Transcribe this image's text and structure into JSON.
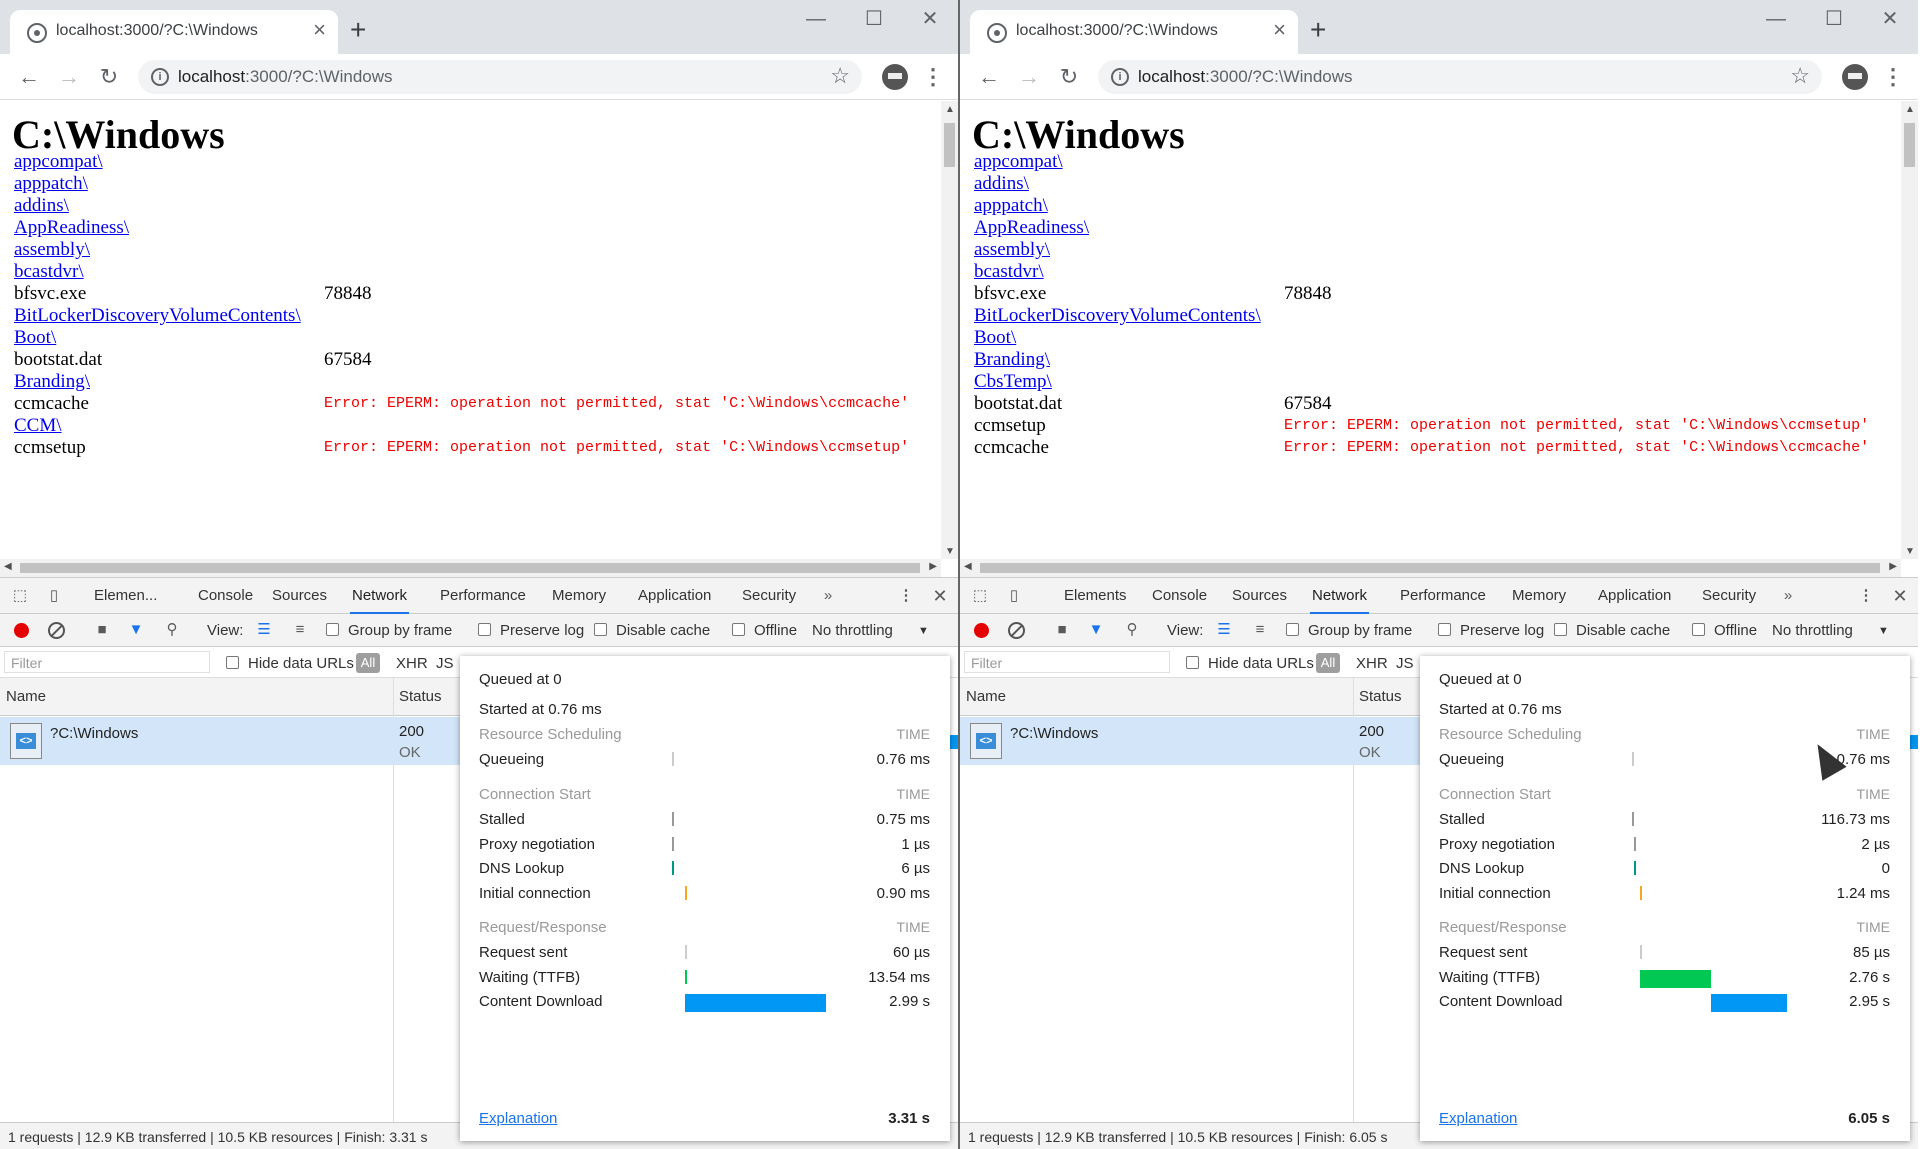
{
  "windows": [
    {
      "tab_title": "localhost:3000/?C:\\Windows",
      "url_host": "localhost",
      "url_rest": ":3000/?C:\\Windows",
      "page_heading": "C:\\Windows",
      "files": [
        {
          "name": "appcompat\\",
          "link": true,
          "size": "",
          "error": ""
        },
        {
          "name": "apppatch\\",
          "link": true,
          "size": "",
          "error": ""
        },
        {
          "name": "addins\\",
          "link": true,
          "size": "",
          "error": ""
        },
        {
          "name": "AppReadiness\\",
          "link": true,
          "size": "",
          "error": ""
        },
        {
          "name": "assembly\\",
          "link": true,
          "size": "",
          "error": ""
        },
        {
          "name": "bcastdvr\\",
          "link": true,
          "size": "",
          "error": ""
        },
        {
          "name": "bfsvc.exe",
          "link": false,
          "size": "78848",
          "error": ""
        },
        {
          "name": "BitLockerDiscoveryVolumeContents\\",
          "link": true,
          "size": "",
          "error": ""
        },
        {
          "name": "Boot\\",
          "link": true,
          "size": "",
          "error": ""
        },
        {
          "name": "bootstat.dat",
          "link": false,
          "size": "67584",
          "error": ""
        },
        {
          "name": "Branding\\",
          "link": true,
          "size": "",
          "error": ""
        },
        {
          "name": "ccmcache",
          "link": false,
          "size": "",
          "error": "Error: EPERM: operation not permitted, stat 'C:\\Windows\\ccmcache'"
        },
        {
          "name": "CCM\\",
          "link": true,
          "size": "",
          "error": ""
        },
        {
          "name": "ccmsetup",
          "link": false,
          "size": "",
          "error": "Error: EPERM: operation not permitted, stat 'C:\\Windows\\ccmsetup'"
        }
      ],
      "devtools": {
        "tabs": [
          "Elemen...",
          "Console",
          "Sources",
          "Network",
          "Performance",
          "Memory",
          "Application",
          "Security"
        ],
        "active_tab": "Network",
        "more": "»",
        "view_label": "View:",
        "group_by_frame": "Group by frame",
        "preserve_log": "Preserve log",
        "disable_cache": "Disable cache",
        "offline": "Offline",
        "throttling": "No throttling",
        "filter_placeholder": "Filter",
        "hide_data_urls": "Hide data URLs",
        "filter_all": "All",
        "filter_xhr": "XHR",
        "filter_js": "JS",
        "col_name": "Name",
        "col_status": "Status",
        "row_name": "?C:\\Windows",
        "row_status": "200",
        "row_status_text": "OK",
        "status_bar": "1 requests  |  12.9 KB transferred  |  10.5 KB resources  |  Finish: 3.31 s",
        "timing": {
          "queued_at": "Queued at 0",
          "started_at": "Started at 0.76 ms",
          "time_label": "TIME",
          "sections": [
            {
              "title": "Resource Scheduling",
              "rows": [
                {
                  "label": "Queueing",
                  "value": "0.76 ms"
                }
              ]
            },
            {
              "title": "Connection Start",
              "rows": [
                {
                  "label": "Stalled",
                  "value": "0.75 ms"
                },
                {
                  "label": "Proxy negotiation",
                  "value": "1 µs"
                },
                {
                  "label": "DNS Lookup",
                  "value": "6 µs"
                },
                {
                  "label": "Initial connection",
                  "value": "0.90 ms"
                }
              ]
            },
            {
              "title": "Request/Response",
              "rows": [
                {
                  "label": "Request sent",
                  "value": "60 µs"
                },
                {
                  "label": "Waiting (TTFB)",
                  "value": "13.54 ms"
                },
                {
                  "label": "Content Download",
                  "value": "2.99 s"
                }
              ]
            }
          ],
          "explanation": "Explanation",
          "total": "3.31 s"
        }
      }
    },
    {
      "tab_title": "localhost:3000/?C:\\Windows",
      "url_host": "localhost",
      "url_rest": ":3000/?C:\\Windows",
      "page_heading": "C:\\Windows",
      "files": [
        {
          "name": "appcompat\\",
          "link": true,
          "size": "",
          "error": ""
        },
        {
          "name": "addins\\",
          "link": true,
          "size": "",
          "error": ""
        },
        {
          "name": "apppatch\\",
          "link": true,
          "size": "",
          "error": ""
        },
        {
          "name": "AppReadiness\\",
          "link": true,
          "size": "",
          "error": ""
        },
        {
          "name": "assembly\\",
          "link": true,
          "size": "",
          "error": ""
        },
        {
          "name": "bcastdvr\\",
          "link": true,
          "size": "",
          "error": ""
        },
        {
          "name": "bfsvc.exe",
          "link": false,
          "size": "78848",
          "error": ""
        },
        {
          "name": "BitLockerDiscoveryVolumeContents\\",
          "link": true,
          "size": "",
          "error": ""
        },
        {
          "name": "Boot\\",
          "link": true,
          "size": "",
          "error": ""
        },
        {
          "name": "Branding\\",
          "link": true,
          "size": "",
          "error": ""
        },
        {
          "name": "CbsTemp\\",
          "link": true,
          "size": "",
          "error": ""
        },
        {
          "name": "bootstat.dat",
          "link": false,
          "size": "67584",
          "error": ""
        },
        {
          "name": "ccmsetup",
          "link": false,
          "size": "",
          "error": "Error: EPERM: operation not permitted, stat 'C:\\Windows\\ccmsetup'"
        },
        {
          "name": "ccmcache",
          "link": false,
          "size": "",
          "error": "Error: EPERM: operation not permitted, stat 'C:\\Windows\\ccmcache'"
        }
      ],
      "devtools": {
        "tabs": [
          "Elements",
          "Console",
          "Sources",
          "Network",
          "Performance",
          "Memory",
          "Application",
          "Security"
        ],
        "active_tab": "Network",
        "more": "»",
        "view_label": "View:",
        "group_by_frame": "Group by frame",
        "preserve_log": "Preserve log",
        "disable_cache": "Disable cache",
        "offline": "Offline",
        "throttling": "No throttling",
        "filter_placeholder": "Filter",
        "hide_data_urls": "Hide data URLs",
        "filter_all": "All",
        "filter_xhr": "XHR",
        "filter_js": "JS",
        "col_name": "Name",
        "col_status": "Status",
        "row_name": "?C:\\Windows",
        "row_status": "200",
        "row_status_text": "OK",
        "status_bar": "1 requests  |  12.9 KB transferred  |  10.5 KB resources  |  Finish: 6.05 s",
        "timing": {
          "queued_at": "Queued at 0",
          "started_at": "Started at 0.76 ms",
          "time_label": "TIME",
          "sections": [
            {
              "title": "Resource Scheduling",
              "rows": [
                {
                  "label": "Queueing",
                  "value": "0.76 ms"
                }
              ]
            },
            {
              "title": "Connection Start",
              "rows": [
                {
                  "label": "Stalled",
                  "value": "116.73 ms"
                },
                {
                  "label": "Proxy negotiation",
                  "value": "2 µs"
                },
                {
                  "label": "DNS Lookup",
                  "value": "0"
                },
                {
                  "label": "Initial connection",
                  "value": "1.24 ms"
                }
              ]
            },
            {
              "title": "Request/Response",
              "rows": [
                {
                  "label": "Request sent",
                  "value": "85 µs"
                },
                {
                  "label": "Waiting (TTFB)",
                  "value": "2.76 s"
                },
                {
                  "label": "Content Download",
                  "value": "2.95 s"
                }
              ]
            }
          ],
          "explanation": "Explanation",
          "total": "6.05 s"
        }
      }
    }
  ],
  "colors": {
    "link": "#0000ee",
    "error": "#ee0000",
    "ttfb_bar": "#00c853",
    "download_bar": "#0097f5",
    "record": "#e60000",
    "accent": "#1a73e8"
  }
}
